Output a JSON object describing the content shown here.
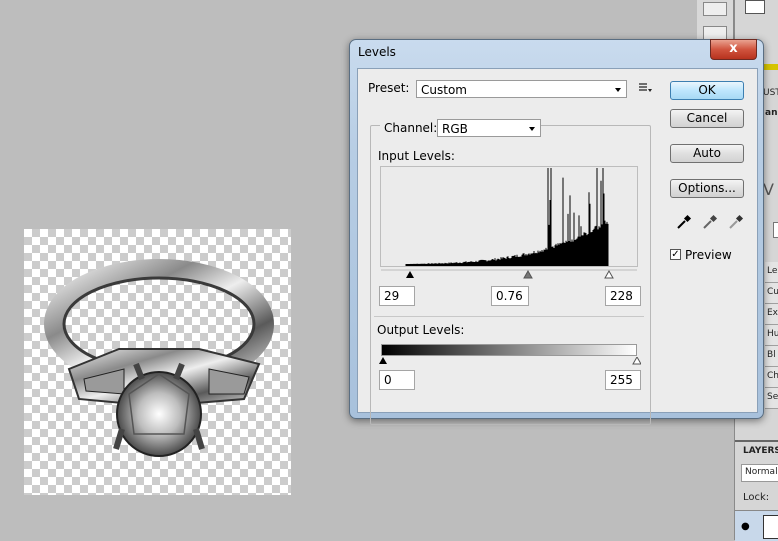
{
  "dialog": {
    "title": "Levels",
    "close_glyph": "x",
    "preset_label": "Preset:",
    "preset_value": "Custom",
    "channel_label": "Channel:",
    "channel_value": "RGB",
    "input_levels_label": "Input Levels:",
    "input_black": "29",
    "input_gamma": "0.76",
    "input_white": "228",
    "output_levels_label": "Output Levels:",
    "output_black": "0",
    "output_white": "255",
    "buttons": {
      "ok": "OK",
      "cancel": "Cancel",
      "auto": "Auto",
      "options": "Options..."
    },
    "preview_label": "Preview",
    "preview_checked": true
  },
  "right_panel": {
    "labels": [
      "UST",
      "an",
      "Le",
      "Cu",
      "Ex",
      "Hu",
      "Bl",
      "Ch",
      "Se"
    ],
    "layers_tab": "LAYERS",
    "blend_mode": "Normal",
    "lock_label": "Lock:"
  },
  "icons": [
    "close-icon",
    "preset-menu-icon",
    "dropdown-arrow-icon",
    "eyedropper-black-icon",
    "eyedropper-gray-icon",
    "eyedropper-white-icon",
    "eye-icon"
  ]
}
